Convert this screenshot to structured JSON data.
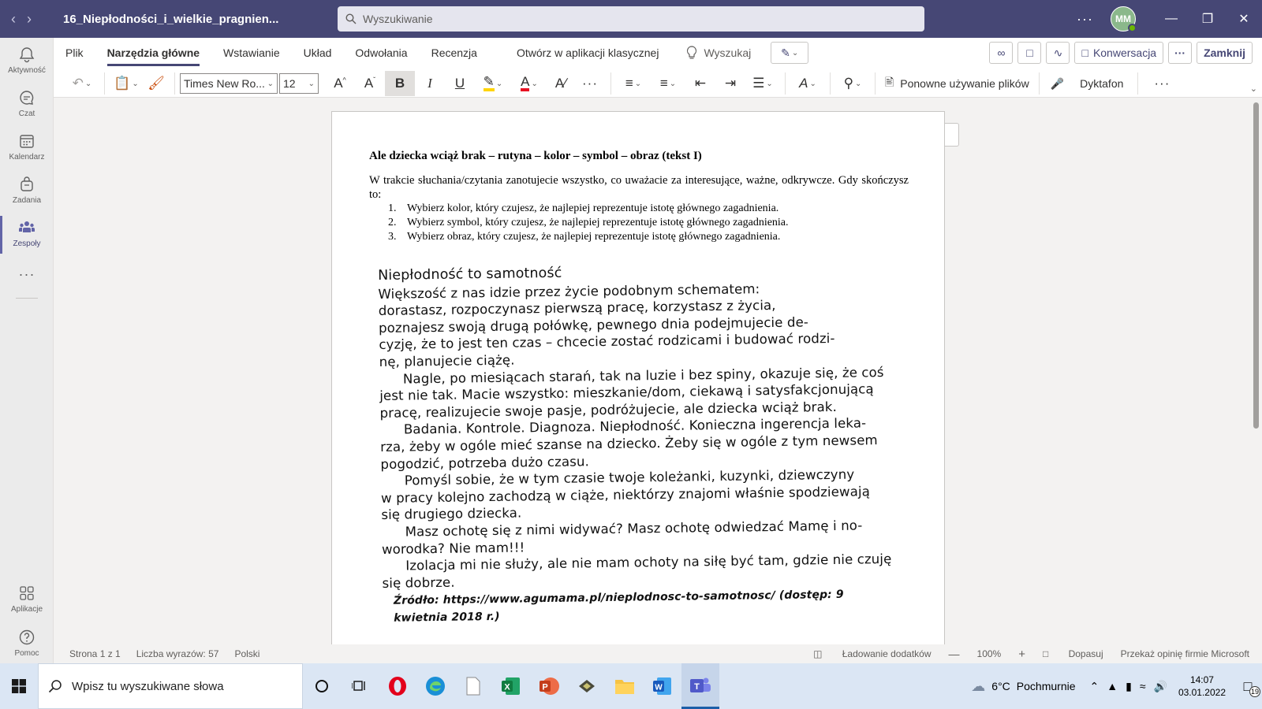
{
  "window": {
    "title": "16_Niepłodności_i_wielkie_pragnien...",
    "search_placeholder": "Wyszukiwanie",
    "user_initials": "MM"
  },
  "rail": [
    {
      "label": "Aktywność",
      "icon": "bell-icon"
    },
    {
      "label": "Czat",
      "icon": "chat-icon"
    },
    {
      "label": "Kalendarz",
      "icon": "calendar-icon"
    },
    {
      "label": "Zadania",
      "icon": "tasks-icon"
    },
    {
      "label": "Zespoły",
      "icon": "teams-icon"
    },
    {
      "label": "Aplikacje",
      "icon": "apps-icon"
    },
    {
      "label": "Pomoc",
      "icon": "help-icon"
    }
  ],
  "ribbon": {
    "tabs": [
      "Plik",
      "Narzędzia główne",
      "Wstawianie",
      "Układ",
      "Odwołania",
      "Recenzja"
    ],
    "active_tab": "Narzędzia główne",
    "open_desktop": "Otwórz w aplikacji klasycznej",
    "lookup": "Wyszukaj",
    "conversation": "Konwersacja",
    "close": "Zamknij",
    "font_name": "Times New Ro...",
    "font_size": "12",
    "reuse_files": "Ponowne używanie plików",
    "dictate": "Dyktafon"
  },
  "document": {
    "heading": "Ale dziecka wciąż brak – rutyna – kolor – symbol – obraz (tekst I)",
    "intro": "W trakcie słuchania/czytania zanotujecie wszystko, co uważacie za interesujące, ważne, odkrywcze. Gdy skończysz to:",
    "list": [
      "Wybierz kolor, który czujesz, że najlepiej reprezentuje istotę głównego zagadnienia.",
      "Wybierz symbol, który czujesz, że najlepiej reprezentuje istotę głównego zagadnienia.",
      "Wybierz obraz, który czujesz, że najlepiej reprezentuje istotę głównego zagadnienia."
    ],
    "scan_title": "Niepłodność to samotność",
    "scan_lines": [
      {
        "text": "Większość z nas idzie przez życie podobnym schematem:",
        "indent": false
      },
      {
        "text": "dorastasz, rozpoczynasz pierwszą pracę, korzystasz z życia,",
        "indent": false
      },
      {
        "text": "poznajesz swoją drugą połówkę, pewnego dnia podejmujecie de-",
        "indent": false
      },
      {
        "text": "cyzję, że to jest ten czas – chcecie zostać rodzicami i budować rodzi-",
        "indent": false
      },
      {
        "text": "nę, planujecie ciążę.",
        "indent": false
      },
      {
        "text": "Nagle, po miesiącach starań, tak na luzie i bez spiny, okazuje się, że coś",
        "indent": true
      },
      {
        "text": "jest nie tak. Macie wszystko: mieszkanie/dom, ciekawą i satysfakcjonującą",
        "indent": false
      },
      {
        "text": "pracę, realizujecie swoje pasje, podróżujecie, ale dziecka wciąż brak.",
        "indent": false
      },
      {
        "text": "Badania. Kontrole. Diagnoza. Niepłodność. Konieczna ingerencja leka-",
        "indent": true
      },
      {
        "text": "rza, żeby w ogóle mieć szanse na dziecko. Żeby się w ogóle z tym newsem",
        "indent": false
      },
      {
        "text": "pogodzić, potrzeba dużo czasu.",
        "indent": false
      },
      {
        "text": "Pomyśl sobie, że w tym czasie twoje koleżanki, kuzynki, dziewczyny",
        "indent": true
      },
      {
        "text": "w pracy kolejno zachodzą w ciąże, niektórzy znajomi właśnie spodziewają",
        "indent": false
      },
      {
        "text": "się drugiego dziecka.",
        "indent": false
      },
      {
        "text": "Masz ochotę się z nimi widywać? Masz ochotę odwiedzać Mamę i no-",
        "indent": true
      },
      {
        "text": "worodka? Nie mam!!!",
        "indent": false
      },
      {
        "text": "Izolacja mi nie służy, ale nie mam ochoty na siłę być tam, gdzie nie czuję",
        "indent": true
      },
      {
        "text": "się dobrze.",
        "indent": false
      }
    ],
    "scan_source": "Źródło: https://www.agumama.pl/nieplodnosc-to-samotnosc/ (dostęp: 9 kwietnia 2018 r.)"
  },
  "status": {
    "page": "Strona 1 z 1",
    "words": "Liczba wyrazów: 57",
    "language": "Polski",
    "addins": "Ładowanie dodatków",
    "zoom": "100%",
    "fit": "Dopasuj",
    "feedback": "Przekaż opinię firmie Microsoft"
  },
  "taskbar": {
    "search_placeholder": "Wpisz tu wyszukiwane słowa",
    "weather_temp": "6°C",
    "weather_desc": "Pochmurnie",
    "time": "14:07",
    "date": "03.01.2022",
    "notifications": "19"
  },
  "colors": {
    "teams_header": "#464775",
    "accent": "#6264a7",
    "highlight": "#ffd400",
    "font_color": "#e81123"
  }
}
